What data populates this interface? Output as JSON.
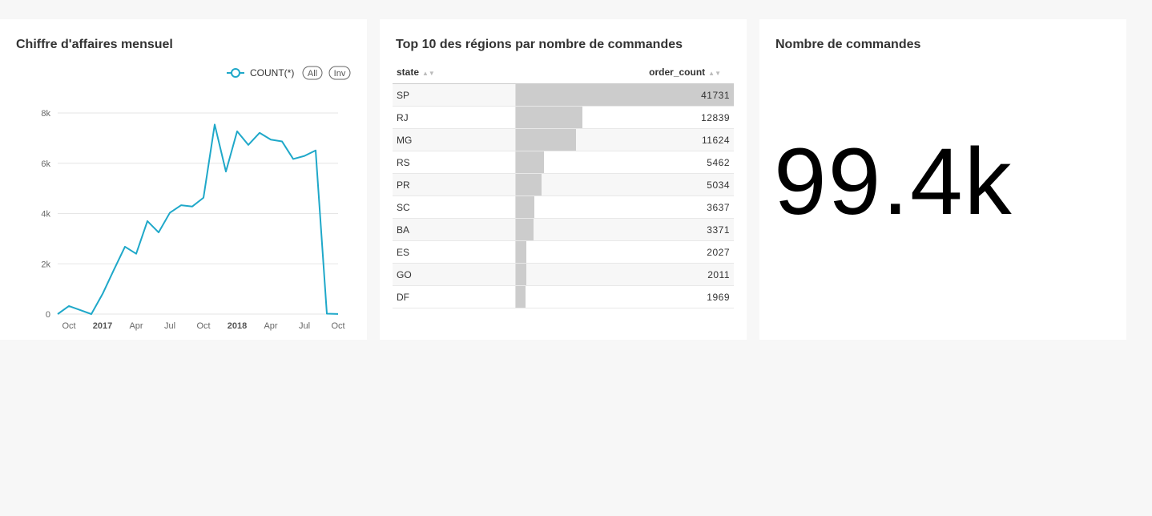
{
  "cards": {
    "revenue": {
      "title": "Chiffre d'affaires mensuel",
      "legend": {
        "series_label": "COUNT(*)",
        "all_label": "All",
        "inv_label": "Inv",
        "color": "#1fa8c9"
      }
    },
    "regions": {
      "title": "Top 10 des régions par nombre de commandes",
      "columns": [
        "state",
        "order_count"
      ],
      "rows": [
        {
          "state": "SP",
          "order_count": "41731"
        },
        {
          "state": "RJ",
          "order_count": "12839"
        },
        {
          "state": "MG",
          "order_count": "11624"
        },
        {
          "state": "RS",
          "order_count": "5462"
        },
        {
          "state": "PR",
          "order_count": "5034"
        },
        {
          "state": "SC",
          "order_count": "3637"
        },
        {
          "state": "BA",
          "order_count": "3371"
        },
        {
          "state": "ES",
          "order_count": "2027"
        },
        {
          "state": "GO",
          "order_count": "2011"
        },
        {
          "state": "DF",
          "order_count": "1969"
        }
      ]
    },
    "orders": {
      "title": "Nombre de commandes",
      "value": "99.4k"
    }
  },
  "chart_data": {
    "type": "line",
    "series": [
      {
        "name": "COUNT(*)",
        "x": [
          "2016-09",
          "2016-10",
          "2016-11",
          "2016-12",
          "2017-01",
          "2017-02",
          "2017-03",
          "2017-04",
          "2017-05",
          "2017-06",
          "2017-07",
          "2017-08",
          "2017-09",
          "2017-10",
          "2017-11",
          "2017-12",
          "2018-01",
          "2018-02",
          "2018-03",
          "2018-04",
          "2018-05",
          "2018-06",
          "2018-07",
          "2018-08",
          "2018-09",
          "2018-10"
        ],
        "values": [
          0,
          320,
          160,
          0,
          800,
          1750,
          2680,
          2400,
          3700,
          3250,
          4030,
          4330,
          4280,
          4630,
          7540,
          5670,
          7270,
          6730,
          7210,
          6940,
          6870,
          6170,
          6290,
          6510,
          16,
          4
        ]
      }
    ],
    "x_tick_labels": [
      "Oct",
      "2017",
      "Apr",
      "Jul",
      "Oct",
      "2018",
      "Apr",
      "Jul",
      "Oct"
    ],
    "y_tick_labels": [
      "0",
      "2k",
      "4k",
      "6k",
      "8k"
    ],
    "ylim": [
      0,
      8000
    ],
    "grid": true,
    "legend": "top-right",
    "color": "#1fa8c9"
  }
}
